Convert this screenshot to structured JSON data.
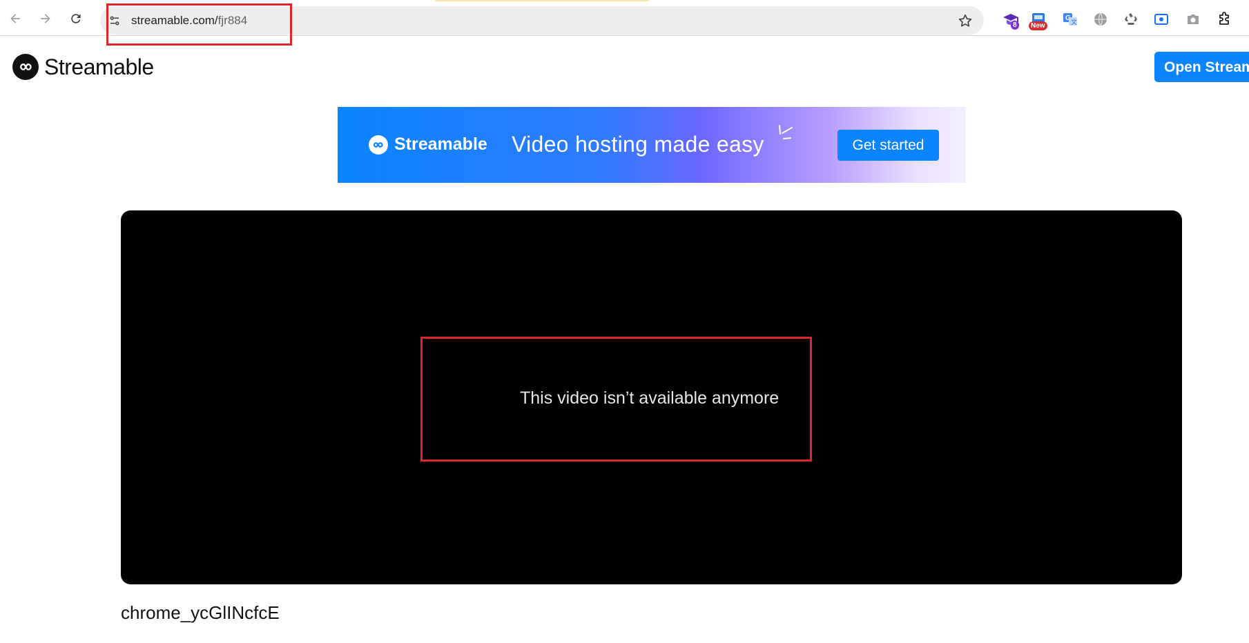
{
  "browser": {
    "url_host": "streamable.com/",
    "url_path": "fjr884",
    "nav": {
      "back_icon": "arrow-left-icon",
      "forward_icon": "arrow-right-icon",
      "reload_icon": "reload-icon"
    },
    "extensions": [
      {
        "icon": "graduation-cap-icon",
        "badge": "8",
        "badge_color": "#7b2fd0"
      },
      {
        "icon": "new-extension-icon",
        "badge": "New",
        "badge_color": "#d32f2f"
      },
      {
        "icon": "translate-icon"
      },
      {
        "icon": "globe-icon"
      },
      {
        "icon": "recycle-icon"
      },
      {
        "icon": "screen-record-icon"
      },
      {
        "icon": "camera-icon"
      },
      {
        "icon": "puzzle-icon"
      }
    ]
  },
  "site": {
    "brand_name": "Streamable",
    "open_button": "Open Streamable"
  },
  "banner": {
    "brand_name": "Streamable",
    "tagline": "Video hosting made easy",
    "cta": "Get started"
  },
  "player": {
    "message": "This video isn’t available anymore"
  },
  "video": {
    "title": "chrome_ycGlINcfcE"
  },
  "colors": {
    "accent": "#0a84ff",
    "annotation": "#e0242c",
    "player_bg": "#000000"
  }
}
